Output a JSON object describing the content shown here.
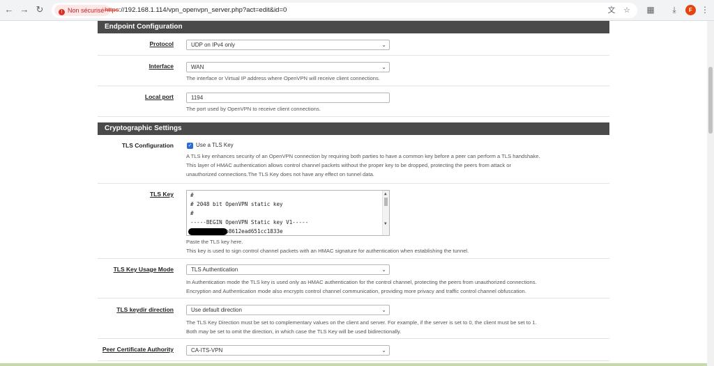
{
  "browser": {
    "security_label": "Non sécurisé",
    "url_scheme": "https",
    "url_rest": "://192.168.1.114/vpn_openvpn_server.php?act=edit&id=0",
    "profile_initial": "F"
  },
  "endpoint": {
    "title": "Endpoint Configuration",
    "protocol": {
      "label": "Protocol",
      "value": "UDP on IPv4 only"
    },
    "interface": {
      "label": "Interface",
      "value": "WAN",
      "help": "The interface or Virtual IP address where OpenVPN will receive client connections."
    },
    "local_port": {
      "label": "Local port",
      "value": "1194",
      "help": "The port used by OpenVPN to receive client connections."
    }
  },
  "crypto": {
    "title": "Cryptographic Settings",
    "tls_config": {
      "label": "TLS Configuration",
      "checkbox_label": "Use a TLS Key",
      "checked": true,
      "help": [
        "A TLS key enhances security of an OpenVPN connection by requiring both parties to have a common key before a peer can perform a TLS handshake.",
        "This layer of HMAC authentication allows control channel packets without the proper key to be dropped, protecting the peers from attack or",
        "unauthorized connections.The TLS Key does not have any effect on tunnel data."
      ]
    },
    "tls_key": {
      "label": "TLS Key",
      "lines": [
        "#",
        "# 2048 bit OpenVPN static key",
        "#",
        "-----BEGIN OpenVPN Static key V1-----",
        "        28bb8612ead651cc1833e"
      ],
      "help": [
        "Paste the TLS key here.",
        "This key is used to sign control channel packets with an HMAC signature for authentication when establishing the tunnel."
      ]
    },
    "tls_usage": {
      "label": "TLS Key Usage Mode",
      "value": "TLS Authentication",
      "help": [
        "In Authentication mode the TLS key is used only as HMAC authentication for the control channel, protecting the peers from unauthorized connections.",
        "Encryption and Authentication mode also encrypts control channel communication, providing more privacy and traffic control channel obfuscation."
      ]
    },
    "tls_keydir": {
      "label": "TLS keydir direction",
      "value": "Use default direction",
      "help": [
        "The TLS Key Direction must be set to complementary values on the client and server. For example, if the server is set to 0, the client must be set to 1.",
        "Both may be set to omit the direction, in which case the TLS Key will be used bidirectionally."
      ]
    },
    "peer_ca": {
      "label": "Peer Certificate Authority",
      "value": "CA-ITS-VPN"
    }
  }
}
